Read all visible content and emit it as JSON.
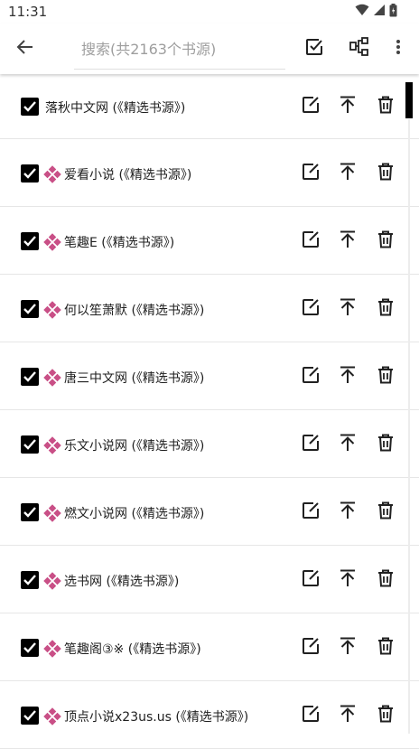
{
  "status_bar": {
    "time": "11:31"
  },
  "toolbar": {
    "search_placeholder": "搜索(共2163个书源)"
  },
  "row_actions": {
    "edit_icon": "edit-icon",
    "top_icon": "move-to-top-icon",
    "delete_icon": "trash-icon"
  },
  "sources": [
    {
      "name": "落秋中文网 (《精选书源》)",
      "checked": true,
      "badge": false
    },
    {
      "name": "爱看小说 (《精选书源》)",
      "checked": true,
      "badge": true
    },
    {
      "name": "笔趣E (《精选书源》)",
      "checked": true,
      "badge": true
    },
    {
      "name": "何以笙萧默 (《精选书源》)",
      "checked": true,
      "badge": true
    },
    {
      "name": "唐三中文网 (《精选书源》)",
      "checked": true,
      "badge": true
    },
    {
      "name": "乐文小说网 (《精选书源》)",
      "checked": true,
      "badge": true
    },
    {
      "name": "燃文小说网 (《精选书源》)",
      "checked": true,
      "badge": true
    },
    {
      "name": " 选书网 (《精选书源》)",
      "checked": true,
      "badge": true
    },
    {
      "name": "笔趣阁③※ (《精选书源》)",
      "checked": true,
      "badge": true
    },
    {
      "name": "顶点小说x23us.us (《精选书源》)",
      "checked": true,
      "badge": true
    }
  ],
  "colors": {
    "badge": "#c94f86",
    "checkbox": "#000000",
    "icon": "#212121"
  }
}
